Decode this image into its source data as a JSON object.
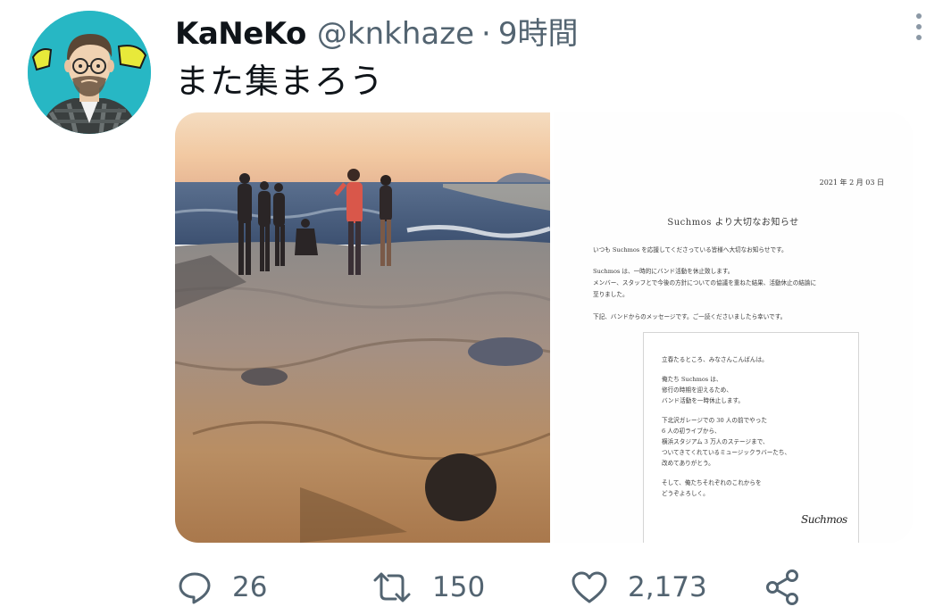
{
  "tweet": {
    "display_name": "KaNeKo",
    "handle": "@knkhaze",
    "separator": "·",
    "time": "9時間",
    "text": "また集まろう"
  },
  "media": {
    "document": {
      "date": "2021 年 2 月 03 日",
      "title": "Suchmos より大切なお知らせ",
      "paragraphs": [
        [
          "いつも Suchmos を応援してくださっている皆様へ大切なお知らせです。"
        ],
        [
          "Suchmos は、一時的にバンド活動を休止致します。",
          "メンバー、スタッフとで今後の方針についての協議を重ねた結果、活動休止の結論に",
          "至りました。"
        ],
        [
          "下記、バンドからのメッセージです。ご一読くださいましたら幸いです。"
        ]
      ],
      "message_lines": [
        "立春たるところ、みなさんこんばんは。",
        "",
        "俺たち Suchmos は、",
        "修行の時期を迎えるため、",
        "バンド活動を一時休止します。",
        "",
        "下北沢ガレージでの 30 人の前でやった",
        "6 人の初ライブから、",
        "横浜スタジアム 3 万人のステージまで、",
        "ついてきてくれているミュージックラバーたち、",
        "改めてありがとう。",
        "",
        "そして、俺たちそれぞれのこれからを",
        "どうぞよろしく。"
      ],
      "signature": "Suchmos"
    }
  },
  "actions": {
    "reply_count": "26",
    "retweet_count": "150",
    "like_count": "2,173"
  },
  "icons": {
    "avatar": "avatar-illustration",
    "more": "more-vertical-icon",
    "reply": "reply-icon",
    "retweet": "retweet-icon",
    "like": "heart-icon",
    "share": "share-icon"
  },
  "colors": {
    "text_primary": "#0f1419",
    "text_secondary": "#536471",
    "avatar_bg": "#27b7c4"
  }
}
